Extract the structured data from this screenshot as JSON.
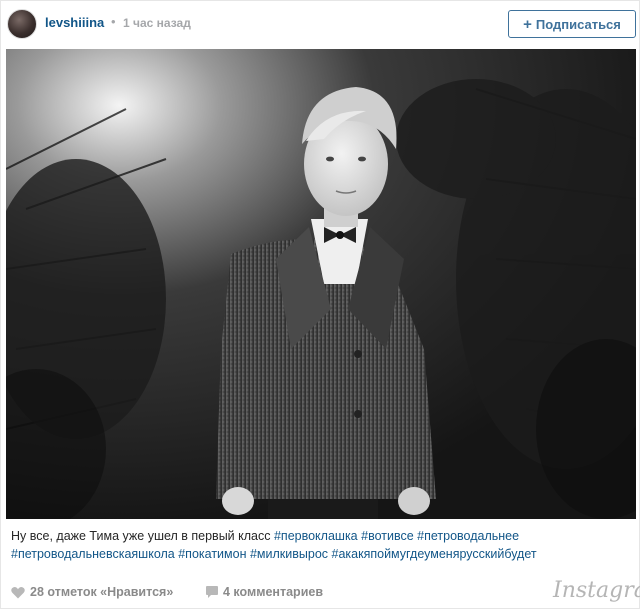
{
  "header": {
    "username": "levshiiina",
    "separator": "•",
    "time": "1 час назад",
    "follow_label": "Подписаться",
    "follow_plus": "+"
  },
  "photo": {
    "description_icon": "photo"
  },
  "caption": {
    "text": "Ну все, даже Тима уже ушел в первый класс",
    "tags": [
      "#первоклашка",
      "#вотивсе",
      "#петроводальнее",
      "#петроводальневскаяшкола",
      "#покатимон",
      "#милкивырос",
      "#акакяпоймугдеуменярусскийбудет"
    ]
  },
  "footer": {
    "likes": "28 отметок «Нравится»",
    "comments": "4 комментариев",
    "brand": "Instagram"
  },
  "colors": {
    "link": "#125688",
    "follow": "#3f729b",
    "muted": "#a5a7aa"
  }
}
